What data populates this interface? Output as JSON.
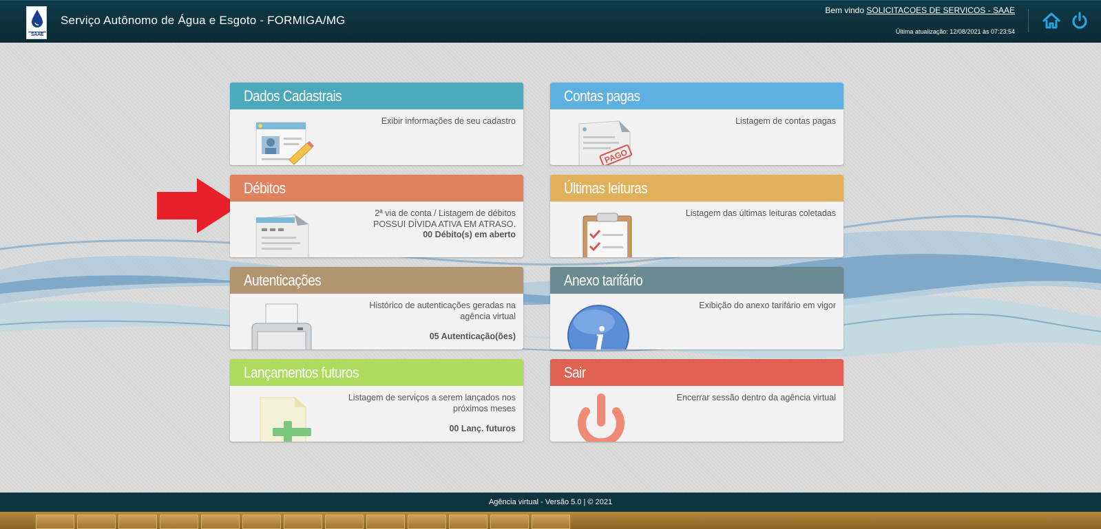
{
  "header": {
    "logo_text": "SAAE",
    "title": "Serviço Autônomo de Água e Esgoto - FORMIGA/MG",
    "welcome_prefix": "Bem vindo",
    "welcome_user": "SOLICITACOES DE SERVICOS - SAAE",
    "last_update": "Última atualização: 12/08/2021 às 07:23:54",
    "icons": [
      "home-icon",
      "power-icon"
    ]
  },
  "cards": {
    "dados": {
      "title": "Dados Cadastrais",
      "desc": "Exibir informações de seu cadastro",
      "color": "#4ca9bb",
      "icon": "profile-form-icon"
    },
    "contas": {
      "title": "Contas pagas",
      "desc": "Listagem de contas pagas",
      "color": "#5eb0e0",
      "icon": "paid-bill-icon",
      "stamp": "PAGO"
    },
    "debitos": {
      "title": "Débitos",
      "desc1": "2ª via de conta / Listagem de débitos",
      "desc2": "POSSUI DÍVIDA ATIVA EM ATRASO.",
      "count": "00 Débito(s) em aberto",
      "color": "#e08260",
      "icon": "bill-icon"
    },
    "leituras": {
      "title": "Últimas leituras",
      "desc": "Listagem das últimas leituras coletadas",
      "color": "#e0b15a",
      "icon": "clipboard-icon"
    },
    "autenticacoes": {
      "title": "Autenticações",
      "desc": "Histórico de autenticações geradas na agência virtual",
      "count": "05 Autenticação(ões)",
      "color": "#b19570",
      "icon": "printer-icon"
    },
    "anexo": {
      "title": "Anexo tarifário",
      "desc": "Exibição do anexo tarifário em vigor",
      "color": "#6a8a92",
      "icon": "info-icon",
      "icon_letter": "i"
    },
    "lancamentos": {
      "title": "Lançamentos futuros",
      "desc": "Listagem de serviços a serem lançados nos próximos meses",
      "count": "00 Lanç. futuros",
      "color": "#addc5c",
      "icon": "add-document-icon"
    },
    "sair": {
      "title": "Sair",
      "desc": "Encerrar sessão dentro da agência virtual",
      "color": "#e06052",
      "icon": "power-icon"
    }
  },
  "annotation": {
    "arrow_color": "#e8202a"
  },
  "footer": {
    "text": "Agência virtual - Versão 5.0 | © 2021"
  }
}
